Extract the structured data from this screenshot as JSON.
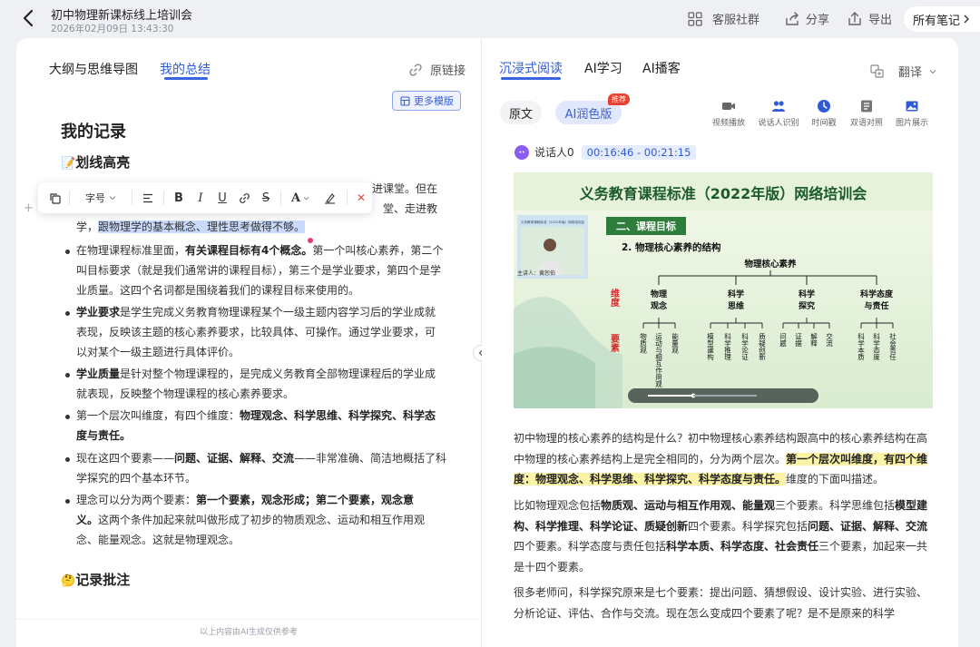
{
  "header": {
    "title": "初中物理新课标线上培训会",
    "timestamp": "2026年02月09日 13:43:30",
    "community": "客服社群",
    "share": "分享",
    "export": "导出",
    "all_notes": "所有笔记"
  },
  "left": {
    "tabs": [
      "大纲与思维导图",
      "我的总结"
    ],
    "origin_link": "原链接",
    "more_templates": "更多模版",
    "record_title": "我的记录",
    "highlight_title": "划线高亮",
    "notes_title": "记录批注",
    "footer": "以上内容由AI生成仅供参考",
    "p0": {
      "a": "进课堂。但在",
      "b": "堂、走进教",
      "c": "学，",
      "sel": "跟物理学的基本概念、理性思考做得不够。"
    },
    "bullets": [
      {
        "l1a": "在物理课程标准里面，",
        "l1b": "有关课程目标有4个概念。",
        "l1c": "第一个叫核心素养，第二个",
        "l2": "叫目标要求（就是我们通常讲的课程目标），第三个是学业要求，第四个是学",
        "l3": "业质量。这四个名词都是围绕着我们的课程目标来使用的。"
      },
      {
        "l1a": "学业要求",
        "l1b": "是学生完成义务教育物理课程某个一级主题内容学习后的学业成就",
        "l2": "表现，反映该主题的核心素养要求，比较具体、可操作。通过学业要求，可",
        "l3": "以对某个一级主题进行具体评价。"
      },
      {
        "l1a": "学业质量",
        "l1b": "是针对整个物理课程的，是完成义务教育全部物理课程后的学业成",
        "l2": "就表现，反映整个物理课程的核心素养要求。"
      },
      {
        "l1a": "第一个层次叫维度，有四个维度：",
        "l1b": "物理观念、科学思维、科学探究、科学态",
        "l2": "度与责任。"
      },
      {
        "l1a": "现在这四个要素——",
        "l1b": "问题、证据、解释、交流",
        "l1c": "——非常准确、简洁地概括了科",
        "l2": "学探究的四个基本环节。"
      },
      {
        "l1a": "理念可以分为两个要素：",
        "l1b": "第一个要素，观念形成；第二个要素，观念意",
        "l2a": "义。",
        "l2b": "这两个条件加起来就叫做形成了初步的物质观念、运动和相互作用观",
        "l3": "念、能量观念。这就是物理观念。"
      }
    ],
    "toolbar": {
      "font_size": "字号",
      "clear": "✕"
    }
  },
  "right": {
    "tabs": [
      "沉浸式阅读",
      "AI学习",
      "AI播客"
    ],
    "translate": "翻译",
    "seg_original": "原文",
    "seg_ai": "AI润色版",
    "badge": "推荐",
    "tools": [
      "视频播放",
      "说话人识别",
      "时间戳",
      "双语对照",
      "图片展示"
    ],
    "speaker": "说话人0",
    "time_range": "00:16:46 - 00:21:15",
    "video": {
      "banner": "义务教育课程标准（2022年版）网络培训会",
      "section": "二、课程目标",
      "subtitle": "2. 物理核心素养的结构",
      "root": "物理核心素养",
      "left_label_1": "维度",
      "left_label_2": "要素",
      "dimensions": [
        "物理观念",
        "科学思维",
        "科学探究",
        "科学态度与责任"
      ],
      "elements": [
        "物质观",
        "运动与相互作用观",
        "能量观",
        "模型建构",
        "科学推理",
        "科学论证",
        "质疑创新",
        "问题",
        "证据",
        "解释",
        "交流",
        "科学本质",
        "科学态度",
        "社会责任"
      ],
      "presenter": "主讲人：黄恕伯",
      "mini_title": "义务教育课程标准（2022年版）网络培训会"
    },
    "para1": {
      "a": "初中物理的核心素养的结构是什么？初中物理核心素养结构跟高中的核心素养结构在高中物理的核心素养结构上是完全相同的，分为两个层次。",
      "hl_a": "第一个层次叫维度，有四个维度：",
      "hl_b": "物理观念、科学思维、科学探究、科学态度与责任。",
      "c": "维度的下面叫描述。"
    },
    "para2": {
      "t1": "比如物理观念包括",
      "b1": "物质观、运动与相互作用观、能量观",
      "t2": "三个要素。科学思维包括",
      "b2": "模型建构、科学推理、科学论证、质疑创新",
      "t3": "四个要素。科学探究包括",
      "b3": "问题、证据、解释、交流",
      "t4": "四个要素。科学态度与责任包括",
      "b4": "科学本质、科学态度、社会责任",
      "t5": "三个要素，加起来一共是十四个要素。"
    },
    "para3": "很多老师问，科学探究原来是七个要素：提出问题、猜想假设、设计实验、进行实验、分析论证、评估、合作与交流。现在怎么变成四个要素了呢？是不是原来的科学"
  }
}
